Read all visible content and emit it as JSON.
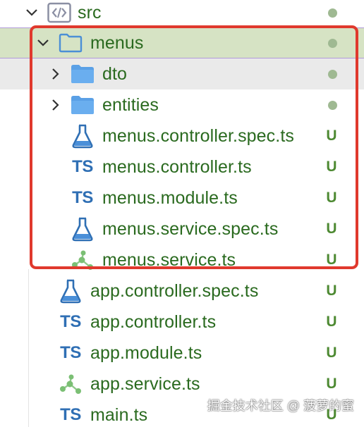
{
  "explorer": {
    "items": [
      {
        "label": "src",
        "icon": "src-folder-icon",
        "status": "dot"
      },
      {
        "label": "menus",
        "icon": "folder-outline-icon",
        "status": "dot"
      },
      {
        "label": "dto",
        "icon": "folder-icon",
        "status": "dot"
      },
      {
        "label": "entities",
        "icon": "folder-icon",
        "status": "dot"
      },
      {
        "label": "menus.controller.spec.ts",
        "icon": "flask-icon",
        "status": "U"
      },
      {
        "label": "menus.controller.ts",
        "icon": "typescript-icon",
        "status": "U"
      },
      {
        "label": "menus.module.ts",
        "icon": "typescript-icon",
        "status": "U"
      },
      {
        "label": "menus.service.spec.ts",
        "icon": "flask-icon",
        "status": "U"
      },
      {
        "label": "menus.service.ts",
        "icon": "nest-service-icon",
        "status": "U"
      },
      {
        "label": "app.controller.spec.ts",
        "icon": "flask-icon",
        "status": "U"
      },
      {
        "label": "app.controller.ts",
        "icon": "typescript-icon",
        "status": "U"
      },
      {
        "label": "app.module.ts",
        "icon": "typescript-icon",
        "status": "U"
      },
      {
        "label": "app.service.ts",
        "icon": "nest-service-icon",
        "status": "U"
      },
      {
        "label": "main.ts",
        "icon": "typescript-icon",
        "status": "U"
      }
    ],
    "ts_icon_text": "TS"
  },
  "watermark": "掘金技术社区 @ 菠萝的蜜",
  "colors": {
    "label": "#2a6a1f",
    "status_u": "#4e8a33",
    "ts_icon": "#2f6fb4",
    "folder": "#5aa0e6",
    "active_row": "#d6e3c4",
    "highlight_border": "#e0392d"
  }
}
